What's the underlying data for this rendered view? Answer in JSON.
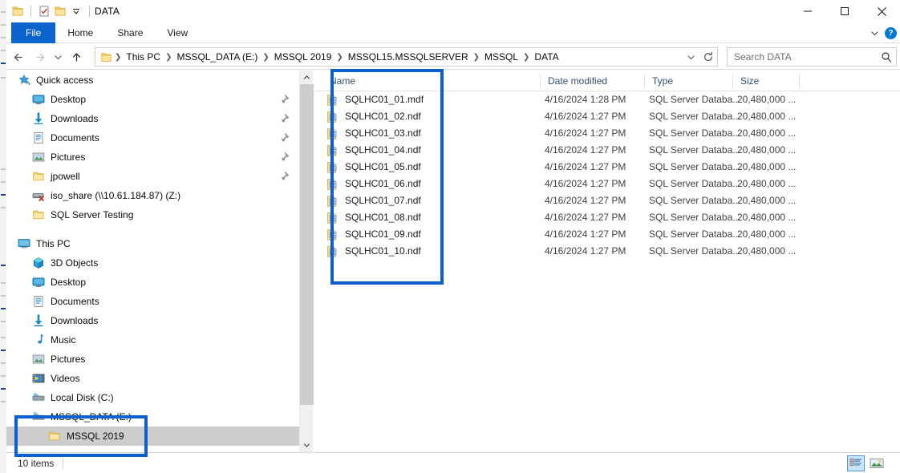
{
  "window": {
    "title": "DATA",
    "quick_access": [
      "folder-icon",
      "properties-icon",
      "new-folder-icon",
      "customize-chevron-icon"
    ],
    "controls": {
      "minimize": "minimize-icon",
      "maximize": "maximize-icon",
      "close": "close-icon"
    }
  },
  "ribbon": {
    "tabs": [
      {
        "label": "File",
        "active": true
      },
      {
        "label": "Home",
        "active": false
      },
      {
        "label": "Share",
        "active": false
      },
      {
        "label": "View",
        "active": false
      }
    ],
    "collapse_icon": "chevron-down-icon",
    "help_label": "?"
  },
  "address": {
    "back_icon": "back-arrow-icon",
    "forward_icon": "forward-arrow-icon",
    "recent_icon": "chevron-down-icon",
    "up_icon": "up-arrow-icon",
    "folder_icon": "folder-icon",
    "breadcrumbs": [
      "This PC",
      "MSSQL_DATA (E:)",
      "MSSQL 2019",
      "MSSQL15.MSSQLSERVER",
      "MSSQL",
      "DATA"
    ],
    "dropdown_icon": "chevron-down-icon",
    "refresh_icon": "refresh-icon"
  },
  "search": {
    "placeholder": "Search DATA",
    "icon": "search-icon"
  },
  "sidebar": {
    "items": [
      {
        "label": "Quick access",
        "icon": "star-icon",
        "indent": 0,
        "pinned": false,
        "selected": false
      },
      {
        "label": "Desktop",
        "icon": "desktop-icon",
        "indent": 1,
        "pinned": true,
        "selected": false
      },
      {
        "label": "Downloads",
        "icon": "download-icon",
        "indent": 1,
        "pinned": true,
        "selected": false
      },
      {
        "label": "Documents",
        "icon": "documents-icon",
        "indent": 1,
        "pinned": true,
        "selected": false
      },
      {
        "label": "Pictures",
        "icon": "pictures-icon",
        "indent": 1,
        "pinned": true,
        "selected": false
      },
      {
        "label": "jpowell",
        "icon": "folder-icon",
        "indent": 1,
        "pinned": true,
        "selected": false
      },
      {
        "label": "iso_share (\\\\10.61.184.87) (Z:)",
        "icon": "network-drive-offline-icon",
        "indent": 1,
        "pinned": false,
        "selected": false
      },
      {
        "label": "SQL Server Testing",
        "icon": "folder-icon",
        "indent": 1,
        "pinned": false,
        "selected": false
      },
      {
        "label": "",
        "icon": "spacer",
        "indent": 0,
        "pinned": false,
        "selected": false
      },
      {
        "label": "This PC",
        "icon": "this-pc-icon",
        "indent": 0,
        "pinned": false,
        "selected": false
      },
      {
        "label": "3D Objects",
        "icon": "3d-objects-icon",
        "indent": 1,
        "pinned": false,
        "selected": false
      },
      {
        "label": "Desktop",
        "icon": "desktop-icon",
        "indent": 1,
        "pinned": false,
        "selected": false
      },
      {
        "label": "Documents",
        "icon": "documents-icon",
        "indent": 1,
        "pinned": false,
        "selected": false
      },
      {
        "label": "Downloads",
        "icon": "download-icon",
        "indent": 1,
        "pinned": false,
        "selected": false
      },
      {
        "label": "Music",
        "icon": "music-icon",
        "indent": 1,
        "pinned": false,
        "selected": false
      },
      {
        "label": "Pictures",
        "icon": "pictures-icon",
        "indent": 1,
        "pinned": false,
        "selected": false
      },
      {
        "label": "Videos",
        "icon": "videos-icon",
        "indent": 1,
        "pinned": false,
        "selected": false
      },
      {
        "label": "Local Disk (C:)",
        "icon": "drive-icon",
        "indent": 1,
        "pinned": false,
        "selected": false
      },
      {
        "label": "MSSQL_DATA (E:)",
        "icon": "drive-icon",
        "indent": 1,
        "pinned": false,
        "selected": false
      },
      {
        "label": "MSSQL 2019",
        "icon": "folder-icon",
        "indent": 2,
        "pinned": false,
        "selected": true
      }
    ],
    "scrollbar": {
      "up_icon": "chevron-up-icon",
      "down_icon": "chevron-down-icon"
    }
  },
  "filelist": {
    "columns": [
      "Name",
      "Date modified",
      "Type",
      "Size"
    ],
    "rows": [
      {
        "name": "SQLHC01_01.mdf",
        "date": "4/16/2024 1:28 PM",
        "type": "SQL Server Databa...",
        "size": "20,480,000 ..."
      },
      {
        "name": "SQLHC01_02.ndf",
        "date": "4/16/2024 1:27 PM",
        "type": "SQL Server Databa...",
        "size": "20,480,000 ..."
      },
      {
        "name": "SQLHC01_03.ndf",
        "date": "4/16/2024 1:27 PM",
        "type": "SQL Server Databa...",
        "size": "20,480,000 ..."
      },
      {
        "name": "SQLHC01_04.ndf",
        "date": "4/16/2024 1:27 PM",
        "type": "SQL Server Databa...",
        "size": "20,480,000 ..."
      },
      {
        "name": "SQLHC01_05.ndf",
        "date": "4/16/2024 1:27 PM",
        "type": "SQL Server Databa...",
        "size": "20,480,000 ..."
      },
      {
        "name": "SQLHC01_06.ndf",
        "date": "4/16/2024 1:27 PM",
        "type": "SQL Server Databa...",
        "size": "20,480,000 ..."
      },
      {
        "name": "SQLHC01_07.ndf",
        "date": "4/16/2024 1:27 PM",
        "type": "SQL Server Databa...",
        "size": "20,480,000 ..."
      },
      {
        "name": "SQLHC01_08.ndf",
        "date": "4/16/2024 1:27 PM",
        "type": "SQL Server Databa...",
        "size": "20,480,000 ..."
      },
      {
        "name": "SQLHC01_09.ndf",
        "date": "4/16/2024 1:27 PM",
        "type": "SQL Server Databa...",
        "size": "20,480,000 ..."
      },
      {
        "name": "SQLHC01_10.ndf",
        "date": "4/16/2024 1:27 PM",
        "type": "SQL Server Databa...",
        "size": "20,480,000 ..."
      }
    ]
  },
  "statusbar": {
    "item_count": "10 items",
    "details_view_icon": "details-view-icon",
    "large_icons_view_icon": "large-icons-view-icon"
  },
  "annotations": {
    "highlight_color": "#0b5fd0",
    "boxes": [
      "file-name-column-highlight",
      "tree-drive-folder-highlight"
    ]
  }
}
